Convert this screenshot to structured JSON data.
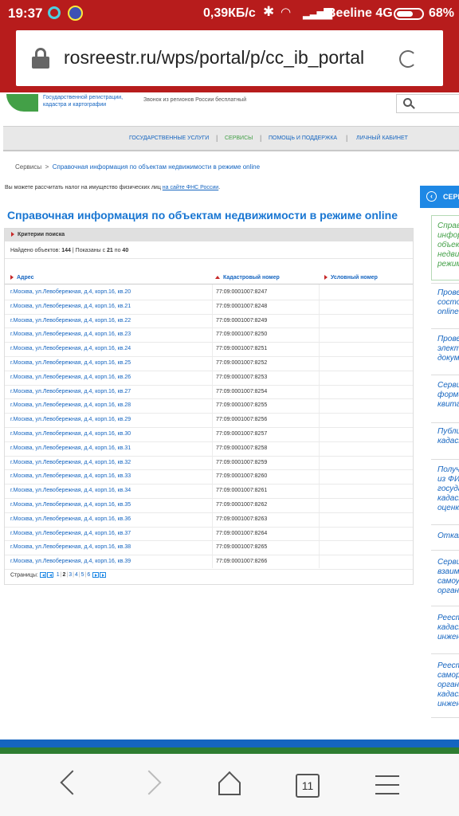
{
  "status_bar": {
    "time": "19:37",
    "speed": "0,39КБ/с",
    "carrier": "Beeline 4G",
    "battery": "68%"
  },
  "browser": {
    "url": "rosreestr.ru/wps/portal/p/cc_ib_portal",
    "tabs_count": "11"
  },
  "site": {
    "logo_line1": "Государственной регистрации,",
    "logo_line2": "кадастра и картографии",
    "hotline": "Звонок из регионов России бесплатный",
    "nav": [
      "ГОСУДАРСТВЕННЫЕ УСЛУГИ",
      "СЕРВИСЫ",
      "ПОМОЩЬ И ПОДДЕРЖКА",
      "ЛИЧНЫЙ КАБИНЕТ"
    ],
    "nav_sep": "|"
  },
  "breadcrumb": {
    "root": "Сервисы",
    "sep": ">",
    "current": "Справочная информация по объектам недвижимости в режиме online"
  },
  "tax_note": {
    "text": "Вы можете рассчитать налог на имущество физических лиц",
    "link": "на сайте ФНС России",
    "end": "."
  },
  "sidebar": {
    "header": "СЕРВИСЫ",
    "items": [
      {
        "lines": [
          "Справочная",
          "информация",
          "объектам",
          "недвижимости",
          "режиме"
        ],
        "active": true
      },
      {
        "lines": [
          "Проверка",
          "состояния",
          "online"
        ],
        "active": false
      },
      {
        "lines": [
          "Проверка",
          "электронного",
          "документа"
        ],
        "active": false
      },
      {
        "lines": [
          "Сервис",
          "формирования",
          "квитанции"
        ],
        "active": false
      },
      {
        "lines": [
          "Публичная",
          "кадастровая"
        ],
        "active": false
      },
      {
        "lines": [
          "Получение",
          "из ФИС",
          "государственной",
          "кадастровой",
          "оценки"
        ],
        "active": false
      },
      {
        "lines": [
          "Отказ"
        ],
        "active": false
      },
      {
        "lines": [
          "Сервис",
          "взаимодействия",
          "самоуправления",
          "органов"
        ],
        "active": false
      },
      {
        "lines": [
          "Реестр",
          "кадастровых",
          "инженеров"
        ],
        "active": false
      },
      {
        "lines": [
          "Реестр",
          "саморегулируемых",
          "организаций",
          "кадастровых",
          "инженеров"
        ],
        "active": false
      }
    ]
  },
  "main": {
    "title": "Справочная информация по объектам недвижимости в режиме online",
    "criteria_label": "Критерии поиска",
    "found_label": "Найдено объектов:",
    "found_count": "144",
    "shown_label": "| Показаны с",
    "shown_from": "21",
    "shown_to_label": "по",
    "shown_to": "40",
    "columns": [
      "Адрес",
      "Кадастровый номер",
      "Условный номер"
    ],
    "rows": [
      {
        "address": "г.Москва, ул.Левобережная, д.4, корп.16, кв.20",
        "cadastral": "77:09:0001007:8247"
      },
      {
        "address": "г.Москва, ул.Левобережная, д.4, корп.16, кв.21",
        "cadastral": "77:09:0001007:8248"
      },
      {
        "address": "г.Москва, ул.Левобережная, д.4, корп.16, кв.22",
        "cadastral": "77:09:0001007:8249"
      },
      {
        "address": "г.Москва, ул.Левобережная, д.4, корп.16, кв.23",
        "cadastral": "77:09:0001007:8250"
      },
      {
        "address": "г.Москва, ул.Левобережная, д.4, корп.16, кв.24",
        "cadastral": "77:09:0001007:8251"
      },
      {
        "address": "г.Москва, ул.Левобережная, д.4, корп.16, кв.25",
        "cadastral": "77:09:0001007:8252"
      },
      {
        "address": "г.Москва, ул.Левобережная, д.4, корп.16, кв.26",
        "cadastral": "77:09:0001007:8253"
      },
      {
        "address": "г.Москва, ул.Левобережная, д.4, корп.16, кв.27",
        "cadastral": "77:09:0001007:8254"
      },
      {
        "address": "г.Москва, ул.Левобережная, д.4, корп.16, кв.28",
        "cadastral": "77:09:0001007:8255"
      },
      {
        "address": "г.Москва, ул.Левобережная, д.4, корп.16, кв.29",
        "cadastral": "77:09:0001007:8256"
      },
      {
        "address": "г.Москва, ул.Левобережная, д.4, корп.16, кв.30",
        "cadastral": "77:09:0001007:8257"
      },
      {
        "address": "г.Москва, ул.Левобережная, д.4, корп.16, кв.31",
        "cadastral": "77:09:0001007:8258"
      },
      {
        "address": "г.Москва, ул.Левобережная, д.4, корп.16, кв.32",
        "cadastral": "77:09:0001007:8259"
      },
      {
        "address": "г.Москва, ул.Левобережная, д.4, корп.16, кв.33",
        "cadastral": "77:09:0001007:8260"
      },
      {
        "address": "г.Москва, ул.Левобережная, д.4, корп.16, кв.34",
        "cadastral": "77:09:0001007:8261"
      },
      {
        "address": "г.Москва, ул.Левобережная, д.4, корп.16, кв.35",
        "cadastral": "77:09:0001007:8262"
      },
      {
        "address": "г.Москва, ул.Левобережная, д.4, корп.16, кв.36",
        "cadastral": "77:09:0001007:8263"
      },
      {
        "address": "г.Москва, ул.Левобережная, д.4, корп.16, кв.37",
        "cadastral": "77:09:0001007:8264"
      },
      {
        "address": "г.Москва, ул.Левобережная, д.4, корп.16, кв.38",
        "cadastral": "77:09:0001007:8265"
      },
      {
        "address": "г.Москва, ул.Левобережная, д.4, корп.16, кв.39",
        "cadastral": "77:09:0001007:8266"
      }
    ],
    "pager": {
      "label": "Страницы:",
      "pages": [
        "1",
        "2",
        "3",
        "4",
        "5",
        "6"
      ],
      "current": "2"
    }
  },
  "colors": {
    "browser_red": "#b71c1c",
    "link_blue": "#1565c0",
    "title_blue": "#1976d2",
    "accent_green": "#43a047"
  }
}
